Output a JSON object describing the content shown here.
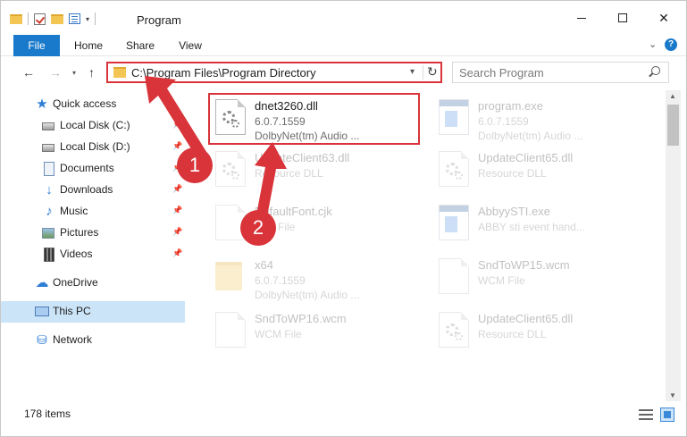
{
  "window": {
    "title": "Program",
    "minimize_label": "—",
    "close_label": "✕"
  },
  "ribbon": {
    "tabs": [
      {
        "label": "File"
      },
      {
        "label": "Home"
      },
      {
        "label": "Share"
      },
      {
        "label": "View"
      }
    ],
    "help_label": "?"
  },
  "nav": {
    "address": "C:\\Program Files\\Program Directory",
    "search_placeholder": "Search Program"
  },
  "sidebar": {
    "items": [
      {
        "label": "Quick access",
        "icon": "star-icon",
        "pinned": false
      },
      {
        "label": "Local Disk (C:)",
        "icon": "disk-icon",
        "pinned": true
      },
      {
        "label": "Local Disk (D:)",
        "icon": "disk-icon",
        "pinned": true
      },
      {
        "label": "Documents",
        "icon": "documents-icon",
        "pinned": true
      },
      {
        "label": "Downloads",
        "icon": "downloads-icon",
        "pinned": true
      },
      {
        "label": "Music",
        "icon": "music-icon",
        "pinned": true
      },
      {
        "label": "Pictures",
        "icon": "pictures-icon",
        "pinned": true
      },
      {
        "label": "Videos",
        "icon": "videos-icon",
        "pinned": true
      },
      {
        "label": "OneDrive",
        "icon": "cloud-icon",
        "pinned": false
      },
      {
        "label": "This PC",
        "icon": "computer-icon",
        "pinned": false,
        "selected": true
      },
      {
        "label": "Network",
        "icon": "network-icon",
        "pinned": false
      }
    ]
  },
  "files": [
    {
      "name": "dnet3260.dll",
      "line1": "6.0.7.1559",
      "line2": "DolbyNet(tm) Audio ...",
      "icon": "gear-file-icon",
      "highlighted": true
    },
    {
      "name": "program.exe",
      "line1": "6.0.7.1559",
      "line2": "DolbyNet(tm) Audio ...",
      "icon": "exe-icon"
    },
    {
      "name": "UpdateClient63.dll",
      "line1": "Resource DLL",
      "line2": "",
      "icon": "gear-file-icon"
    },
    {
      "name": "UpdateClient65.dll",
      "line1": "Resource DLL",
      "line2": "",
      "icon": "gear-file-icon"
    },
    {
      "name": "DefaultFont.cjk",
      "line1": "CJK File",
      "line2": "",
      "icon": "file-icon"
    },
    {
      "name": "AbbyySTI.exe",
      "line1": "ABBY sti event hand...",
      "line2": "",
      "icon": "exe-icon"
    },
    {
      "name": "x64",
      "line1": "6.0.7.1559",
      "line2": "DolbyNet(tm) Audio ...",
      "icon": "folder-icon"
    },
    {
      "name": "SndToWP15.wcm",
      "line1": "WCM File",
      "line2": "",
      "icon": "file-icon"
    },
    {
      "name": "SndToWP16.wcm",
      "line1": "WCM File",
      "line2": "",
      "icon": "file-icon"
    },
    {
      "name": "UpdateClient65.dll",
      "line1": "Resource DLL",
      "line2": "",
      "icon": "gear-file-icon"
    }
  ],
  "status": {
    "item_count": "178 items"
  },
  "annotations": {
    "step1": "1",
    "step2": "2",
    "color": "#d8343a"
  }
}
